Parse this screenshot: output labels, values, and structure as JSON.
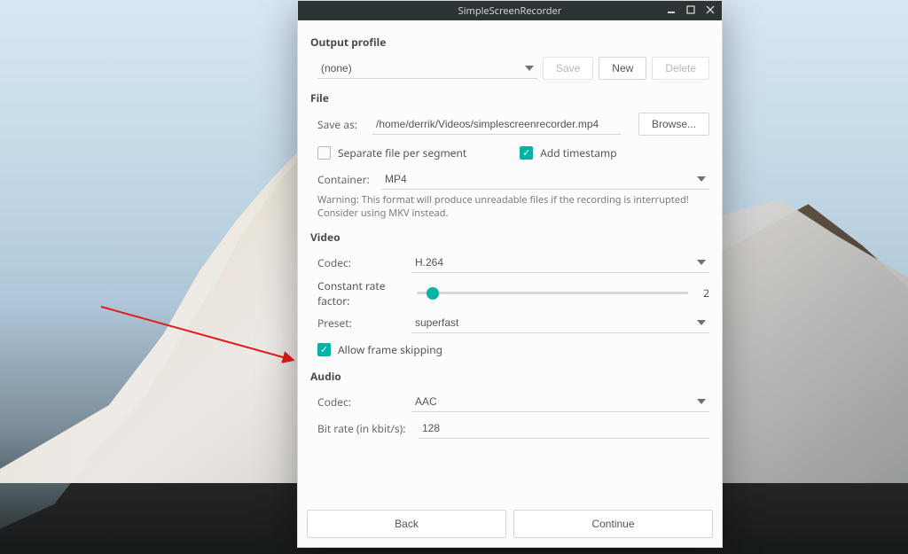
{
  "window": {
    "title": "SimpleScreenRecorder"
  },
  "output_profile": {
    "heading": "Output profile",
    "selected": "(none)",
    "save_btn": "Save",
    "new_btn": "New",
    "delete_btn": "Delete"
  },
  "file": {
    "heading": "File",
    "save_as_label": "Save as:",
    "save_as_value": "/home/derrik/Videos/simplescreenrecorder.mp4",
    "browse_btn": "Browse...",
    "separate_file_label": "Separate file per segment",
    "separate_file_checked": false,
    "add_timestamp_label": "Add timestamp",
    "add_timestamp_checked": true,
    "container_label": "Container:",
    "container_value": "MP4",
    "warning": "Warning: This format will produce unreadable files if the recording is interrupted! Consider using MKV instead."
  },
  "video": {
    "heading": "Video",
    "codec_label": "Codec:",
    "codec_value": "H.264",
    "crf_label": "Constant rate factor:",
    "crf_value": 2,
    "crf_min": 0,
    "crf_max": 51,
    "preset_label": "Preset:",
    "preset_value": "superfast",
    "allow_frame_skipping_label": "Allow frame skipping",
    "allow_frame_skipping_checked": true
  },
  "audio": {
    "heading": "Audio",
    "codec_label": "Codec:",
    "codec_value": "AAC",
    "bitrate_label": "Bit rate (in kbit/s):",
    "bitrate_value": "128"
  },
  "footer": {
    "back": "Back",
    "continue": "Continue"
  },
  "colors": {
    "accent": "#00b3a4"
  }
}
